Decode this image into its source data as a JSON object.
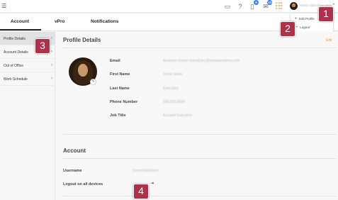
{
  "topbar": {
    "icons": [
      "menu-icon",
      "chat-icon",
      "help-icon",
      "notification-icon",
      "mail-icon",
      "apps-icon"
    ],
    "notification_badge": "8",
    "mail_badge": "10",
    "user_name": "Demo Sales Executive"
  },
  "dropdown": {
    "edit_profile": "Edit Profile",
    "logout": "Logout"
  },
  "tabs": [
    {
      "label": "Account"
    },
    {
      "label": "vPro"
    },
    {
      "label": "Notifications"
    }
  ],
  "sidebar": {
    "items": [
      {
        "label": "Profile Details"
      },
      {
        "label": "Account Details"
      },
      {
        "label": "Out of Office"
      },
      {
        "label": "Work Schedule"
      }
    ]
  },
  "profile": {
    "title": "Profile Details",
    "edit": "Edit",
    "fields": [
      {
        "label": "Email",
        "value": "Anatreon-Demo-SalesExec@vsnsalesdemo.com"
      },
      {
        "label": "First Name",
        "value": "Demo Sales"
      },
      {
        "label": "Last Name",
        "value": "Executive"
      },
      {
        "label": "Phone Number",
        "value": "555-555-5555"
      },
      {
        "label": "Job Title",
        "value": "Account Executive"
      }
    ]
  },
  "account": {
    "title": "Account",
    "username_label": "Username",
    "username_value": "DemoSalesExec",
    "logout_all_label": "Logout on all devices"
  },
  "markers": [
    "1",
    "2",
    "3",
    "4"
  ]
}
